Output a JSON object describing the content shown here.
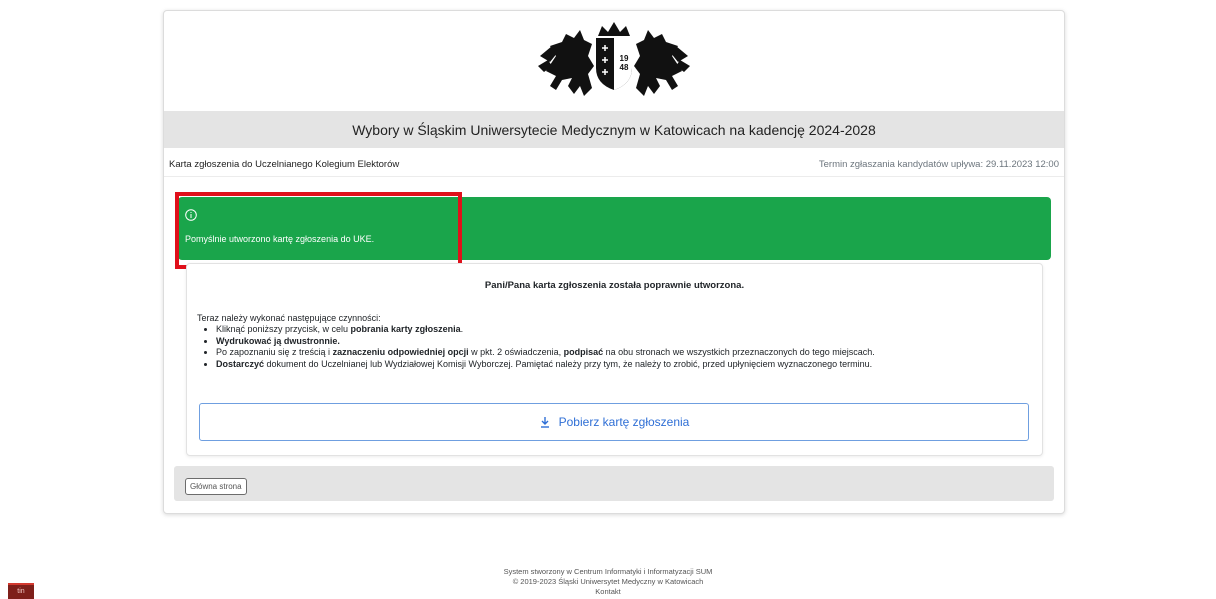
{
  "header": {
    "logo_text": "19 48",
    "title": "Wybory w Śląskim Uniwersytecie Medycznym w Katowicach na kadencję 2024-2028"
  },
  "subheader": {
    "left": "Karta zgłoszenia do Uczelnianego Kolegium Elektorów",
    "right": "Termin zgłaszania kandydatów upływa: 29.11.2023 12:00"
  },
  "alert": {
    "icon": "info-circle-icon",
    "message": "Pomyślnie utworzono kartę zgłoszenia do UKE.",
    "color": "#1aa54b"
  },
  "panel": {
    "heading": "Pani/Pana karta zgłoszenia została poprawnie utworzona.",
    "intro": "Teraz należy wykonać następujące czynności:",
    "steps": [
      {
        "a": "Kliknąć poniższy przycisk, w celu ",
        "b": "pobrania karty zgłoszenia",
        "c": "."
      },
      {
        "a": "",
        "b": "Wydrukować ją dwustronnie.",
        "c": ""
      },
      {
        "a": "Po zapoznaniu się z treścią i ",
        "b": "zaznaczeniu odpowiedniej opcji",
        "c": " w pkt. 2 oświadczenia, ",
        "d": "podpisać",
        "e": " na obu stronach we wszystkich przeznaczonych do tego miejscach."
      },
      {
        "a": "",
        "b": "Dostarczyć",
        "c": " dokument do Uczelnianej lub Wydziałowej Komisji Wyborczej. Pamiętać należy przy tym, że należy to zrobić, przed upłynięciem wyznaczonego terminu."
      }
    ],
    "download_label": "Pobierz kartę zgłoszenia",
    "download_icon": "download-icon"
  },
  "footer_bar": {
    "home_label": "Główna strona"
  },
  "site_footer": {
    "line1": "System stworzony w Centrum Informatyki i Informatyzacji SUM",
    "line2": "© 2019-2023 Śląski Uniwersytet Medyczny w Katowicach",
    "line3": "Kontakt"
  },
  "taskbar": {
    "icon": "app-icon",
    "label": "tin"
  }
}
